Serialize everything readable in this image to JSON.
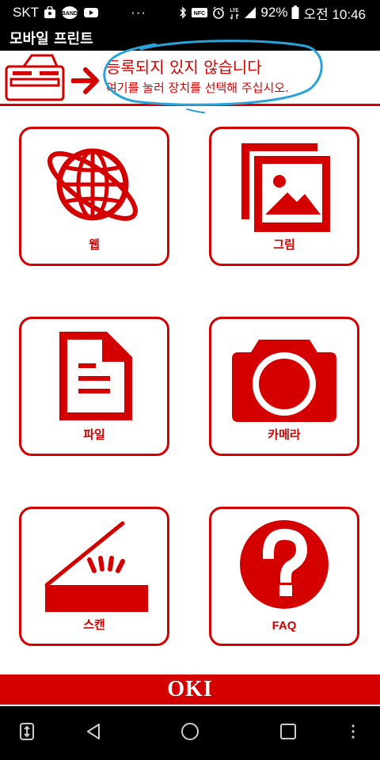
{
  "status_bar": {
    "carrier": "SKT",
    "band_label": "BAND",
    "overflow": "···",
    "nfc_label": "NFC",
    "lte_label": "LTE",
    "battery": "92%",
    "time": "오전 10:46"
  },
  "app_bar": {
    "title": "모바일 프린트"
  },
  "banner": {
    "title": "등록되지 있지 않습니다",
    "subtitle": "여기를 눌러 장치를 선택해 주십시오."
  },
  "tiles": [
    {
      "label": "웹",
      "icon": "globe-icon"
    },
    {
      "label": "그림",
      "icon": "pictures-icon"
    },
    {
      "label": "파일",
      "icon": "document-icon"
    },
    {
      "label": "카메라",
      "icon": "camera-icon"
    },
    {
      "label": "스캔",
      "icon": "scanner-icon"
    },
    {
      "label": "FAQ",
      "icon": "question-icon"
    }
  ],
  "footer": {
    "logo": "OKI"
  },
  "colors": {
    "accent": "#d40000",
    "annotation": "#2aa3d8",
    "bars": "#000000"
  }
}
